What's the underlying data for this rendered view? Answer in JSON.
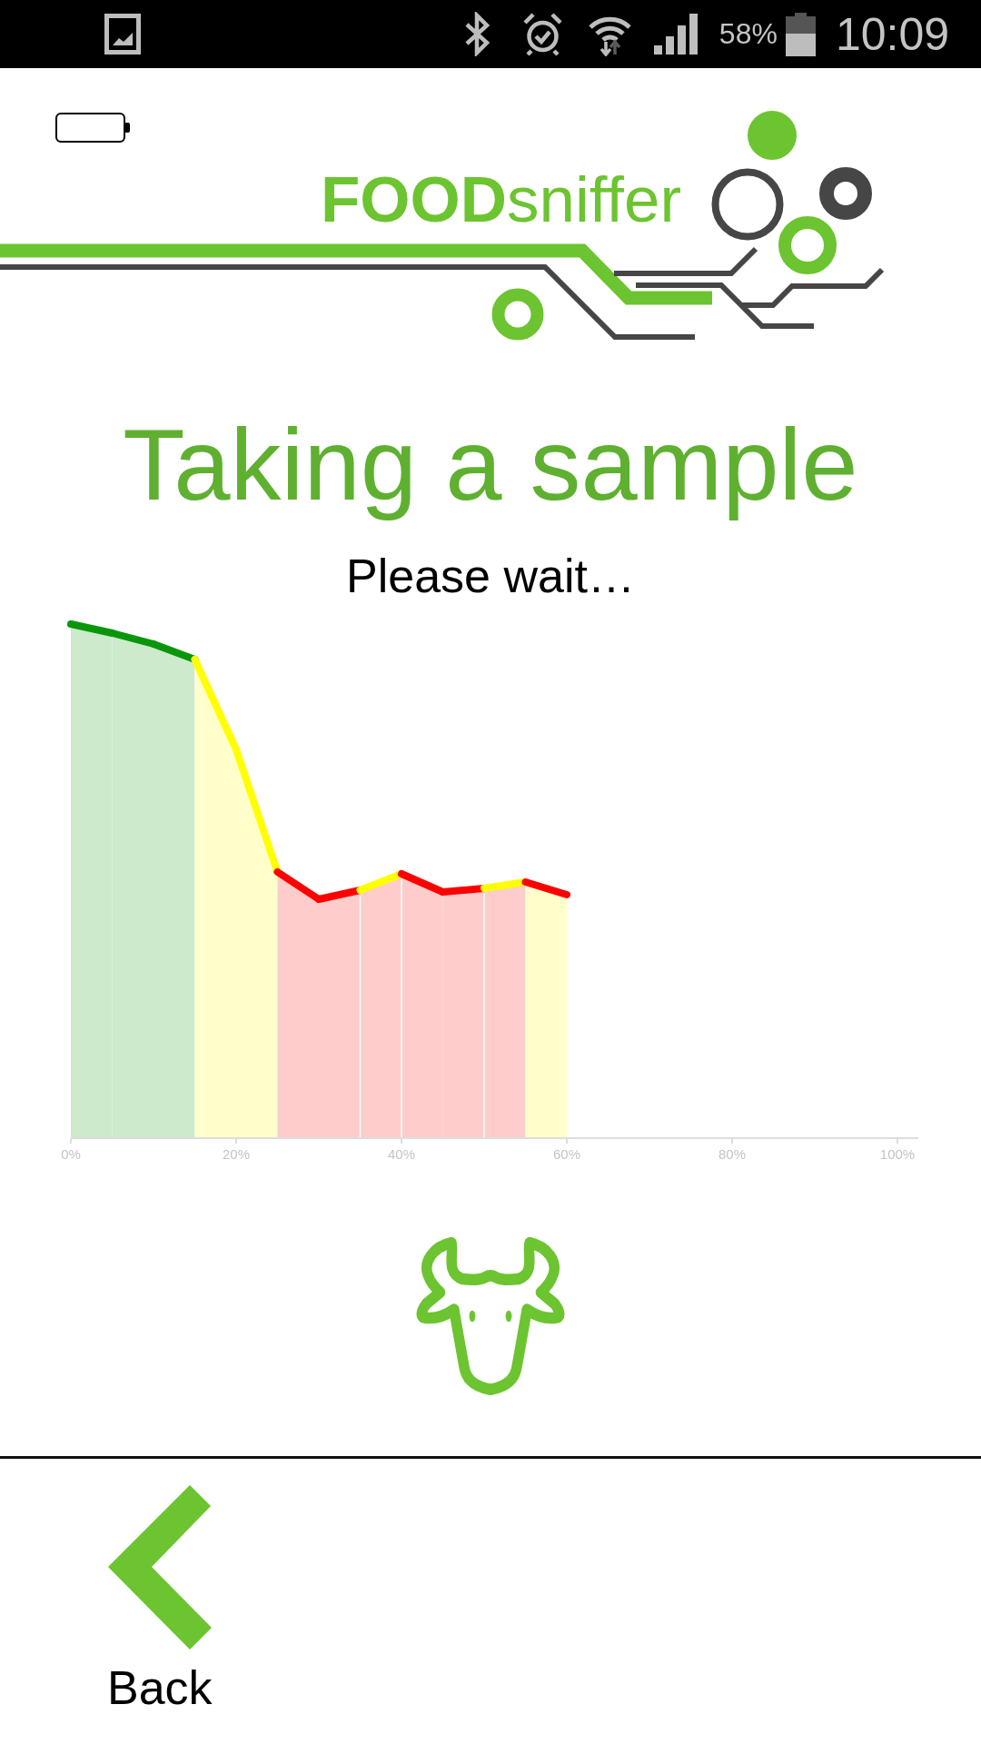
{
  "status_bar": {
    "battery": "58%",
    "time": "10:09"
  },
  "header": {
    "brand": "**FOOD**sniffer"
  },
  "title": "Taking a sample",
  "message": "Please wait…",
  "chart": {
    "x_axis_labels": [
      "0%",
      "20%",
      "40%",
      "60%",
      "80%",
      "100%"
    ]
  },
  "back_button": {
    "label": "Back"
  }
}
